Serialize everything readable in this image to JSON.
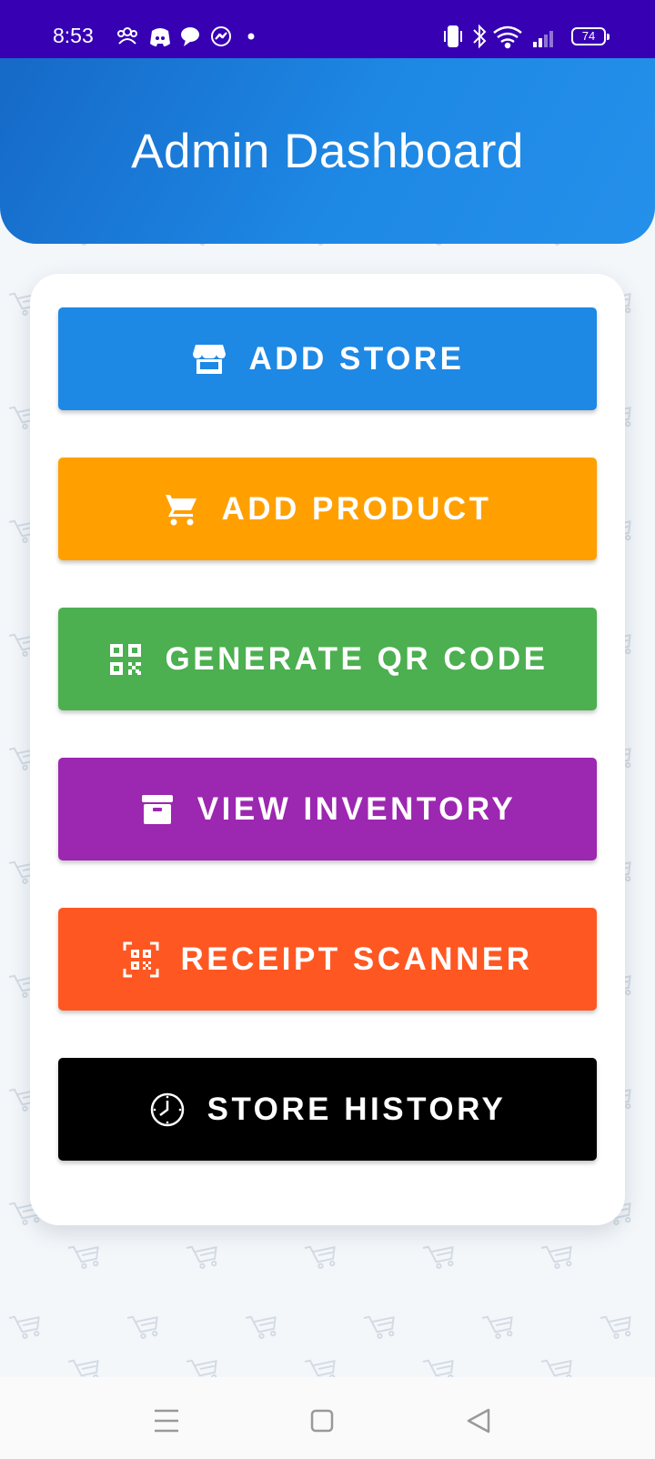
{
  "status_bar": {
    "time": "8:53",
    "battery": "74",
    "left_icons": [
      "group-icon",
      "discord-icon",
      "chat-bubble-icon",
      "messenger-icon",
      "dot-icon"
    ],
    "right_icons": [
      "vibrate-icon",
      "bluetooth-icon",
      "wifi-icon",
      "signal-icon",
      "battery-icon"
    ],
    "color": "#3700b3"
  },
  "header": {
    "title": "Admin Dashboard",
    "color": "#1e88e5"
  },
  "buttons": [
    {
      "label": "ADD STORE",
      "icon": "store-icon",
      "color": "#1e88e5"
    },
    {
      "label": "ADD PRODUCT",
      "icon": "cart-icon",
      "color": "#ffa000"
    },
    {
      "label": "GENERATE QR CODE",
      "icon": "qr-code-icon",
      "color": "#4caf50"
    },
    {
      "label": "VIEW INVENTORY",
      "icon": "inventory-box-icon",
      "color": "#9c27b0"
    },
    {
      "label": "RECEIPT SCANNER",
      "icon": "qr-scanner-icon",
      "color": "#ff5722"
    },
    {
      "label": "STORE HISTORY",
      "icon": "clock-icon",
      "color": "#000000"
    }
  ],
  "nav_bar": {
    "items": [
      "menu-icon",
      "home-square-icon",
      "back-triangle-icon"
    ]
  },
  "background_pattern_icon": "shopping-cart-icon"
}
